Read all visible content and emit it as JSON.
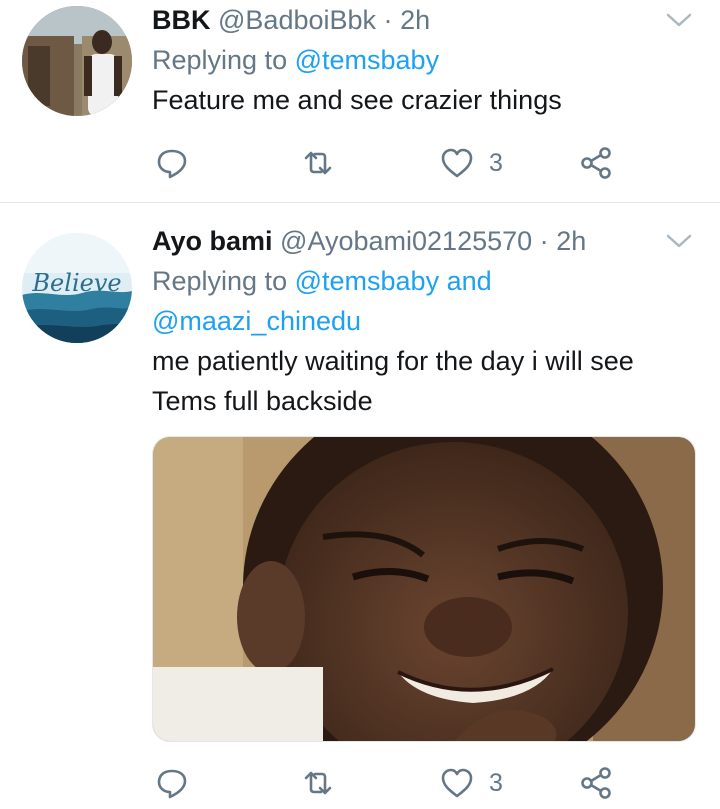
{
  "tweets": [
    {
      "name": "BBK",
      "handle": "@BadboiBbk",
      "separator": "·",
      "time": "2h",
      "replying_prefix": "Replying to",
      "mentions": [
        "@temsbaby"
      ],
      "text": "Feature me and see crazier things",
      "like_count": "3",
      "icons": [
        "reply-icon",
        "retweet-icon",
        "heart-icon",
        "share-icon",
        "chevron-down-icon"
      ]
    },
    {
      "name": "Ayo bami",
      "handle": "@Ayobami02125570",
      "separator": "·",
      "time": "2h",
      "replying_prefix": "Replying to",
      "mentions": [
        "@temsbaby",
        "@maazi_chinedu"
      ],
      "mention_joiner": "and",
      "text": "me patiently waiting for the day i will see Tems full backside",
      "avatar_text": "Believe",
      "like_count": "3",
      "icons": [
        "reply-icon",
        "retweet-icon",
        "heart-icon",
        "share-icon",
        "chevron-down-icon"
      ]
    }
  ],
  "colors": {
    "link": "#1da1f2",
    "secondary_text": "#657786",
    "primary_text": "#14171a",
    "divider": "#e1e8ed"
  }
}
